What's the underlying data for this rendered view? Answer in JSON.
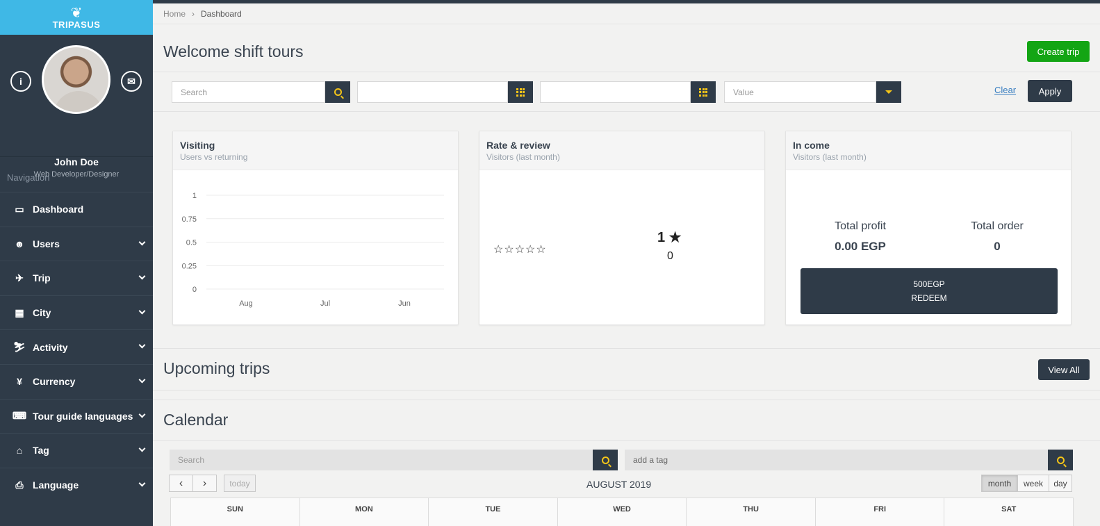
{
  "brand": {
    "logo_mark": "❦",
    "logo_text": "TRIPASUS"
  },
  "profile": {
    "name": "John Doe",
    "role": "Web Developer/Designer",
    "info_glyph": "i",
    "mail_glyph": "✉"
  },
  "nav": {
    "heading": "Navigation",
    "items": [
      {
        "label": "Dashboard",
        "icon": "monitor-icon",
        "glyph": "▭"
      },
      {
        "label": "Users",
        "icon": "users-icon",
        "glyph": "☻"
      },
      {
        "label": "Trip",
        "icon": "plane-icon",
        "glyph": "✈"
      },
      {
        "label": "City",
        "icon": "building-icon",
        "glyph": "▦"
      },
      {
        "label": "Activity",
        "icon": "skier-icon",
        "glyph": "⛷"
      },
      {
        "label": "Currency",
        "icon": "yen-icon",
        "glyph": "¥"
      },
      {
        "label": "Tour guide languages",
        "icon": "language-icon",
        "glyph": "⌨"
      },
      {
        "label": "Tag",
        "icon": "tags-icon",
        "glyph": "⌂"
      },
      {
        "label": "Language",
        "icon": "book-icon",
        "glyph": "⎙"
      }
    ]
  },
  "breadcrumb": {
    "home": "Home",
    "sep": "›",
    "current": "Dashboard"
  },
  "header": {
    "welcome": "Welcome shift tours",
    "create_label": "Create trip"
  },
  "filters": {
    "search_placeholder": "Search",
    "value_placeholder": "Value",
    "clear_label": "Clear",
    "apply_label": "Apply"
  },
  "cards": {
    "visiting": {
      "title": "Visiting",
      "subtitle": "Users vs returning"
    },
    "rate": {
      "title": "Rate & review",
      "subtitle": "Visitors (last month)",
      "stars": "☆☆☆☆☆",
      "rating": "1 ★",
      "count": "0"
    },
    "income": {
      "title": "In come",
      "subtitle": "Visitors (last month)",
      "profit_label": "Total profit",
      "profit_value": "0.00 EGP",
      "order_label": "Total order",
      "order_value": "0",
      "redeem_amount": "500EGP",
      "redeem_label": "REDEEM"
    }
  },
  "chart_data": {
    "type": "line",
    "categories": [
      "Aug",
      "Jul",
      "Jun"
    ],
    "series": [
      {
        "values": [
          0,
          0,
          0
        ]
      }
    ],
    "ylim": [
      0,
      1
    ],
    "yticks": [
      "1",
      "0.75",
      "0.5",
      "0.25",
      "0"
    ],
    "grid": true
  },
  "upcoming": {
    "title": "Upcoming trips",
    "view_all_label": "View All"
  },
  "calendar": {
    "title": "Calendar",
    "search_placeholder": "Search",
    "tag_placeholder": "add a tag",
    "prev": "‹",
    "next": "›",
    "today": "today",
    "month_title": "AUGUST 2019",
    "views": [
      "month",
      "week",
      "day"
    ],
    "days": [
      "SUN",
      "MON",
      "TUE",
      "WED",
      "THU",
      "FRI",
      "SAT"
    ]
  }
}
